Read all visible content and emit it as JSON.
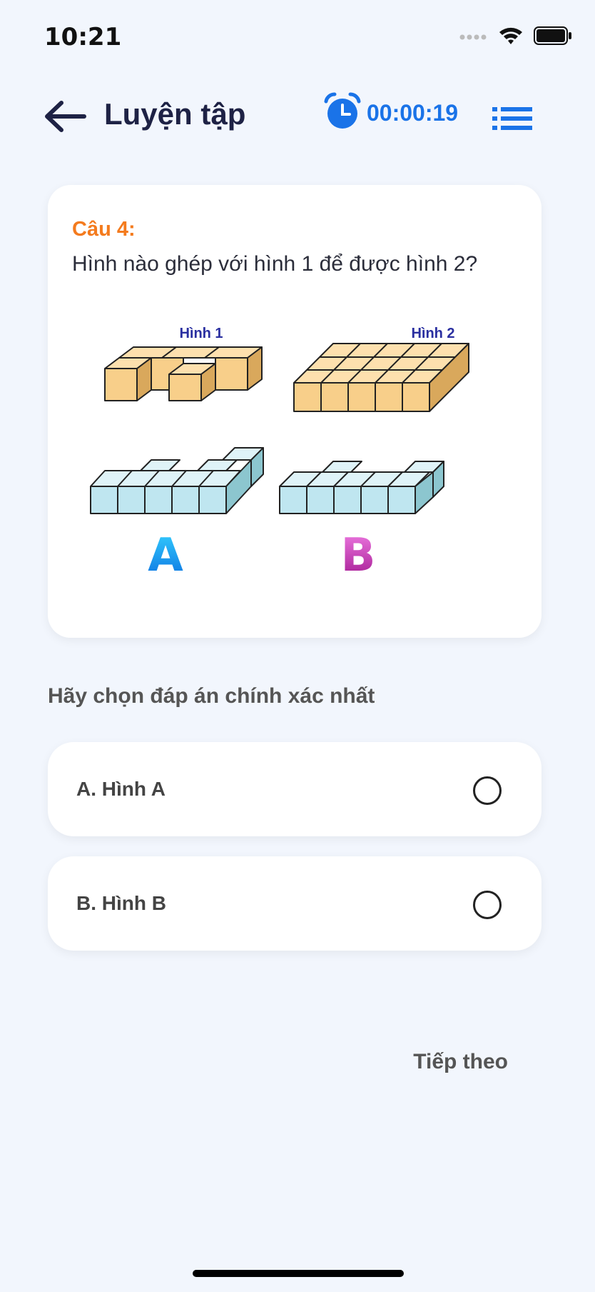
{
  "status": {
    "time": "10:21"
  },
  "header": {
    "title": "Luyện tập",
    "timer": "00:00:19"
  },
  "question": {
    "number": "Câu 4:",
    "text": "Hình nào ghép với hình 1 để được hình 2?",
    "figure": {
      "label_1": "Hình 1",
      "label_2": "Hình 2",
      "choice_a": "A",
      "choice_b": "B"
    }
  },
  "prompt": "Hãy chọn đáp án chính xác nhất",
  "options": [
    {
      "label": "A. Hình A"
    },
    {
      "label": "B. Hình B"
    }
  ],
  "next_label": "Tiếp theo",
  "colors": {
    "background": "#f2f6fd",
    "accent": "#1a73e8",
    "question_number": "#f47b1e",
    "cube_orange": "#f8cf8a",
    "cube_blue": "#bfe6f0",
    "letter_a": "#1aa7e8",
    "letter_b": "#c21bb0"
  }
}
